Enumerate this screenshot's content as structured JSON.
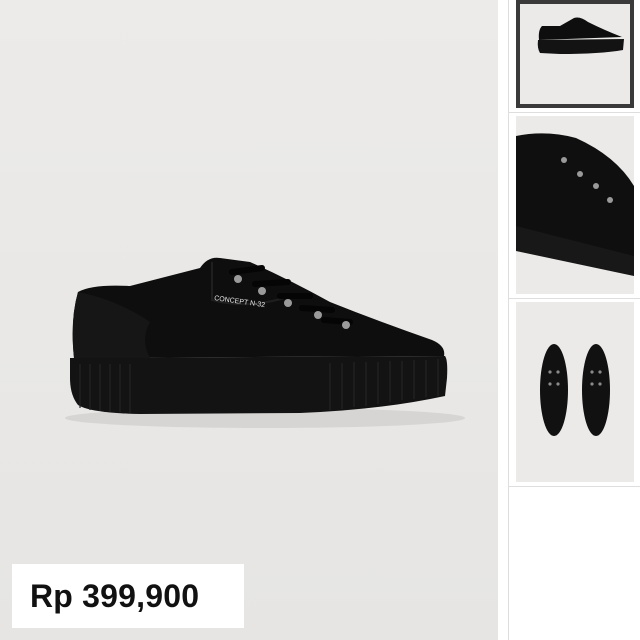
{
  "product": {
    "price": "Rp 399,900",
    "brand_print": "CONCEPT N-32"
  },
  "gallery": {
    "thumbnails": [
      {
        "view": "side view",
        "selected": true
      },
      {
        "view": "close-up",
        "selected": false
      },
      {
        "view": "top view pair",
        "selected": false
      }
    ]
  },
  "colors": {
    "shoe": "#111111",
    "background": "#e9e8e6",
    "active_border": "#3a3a3a"
  }
}
